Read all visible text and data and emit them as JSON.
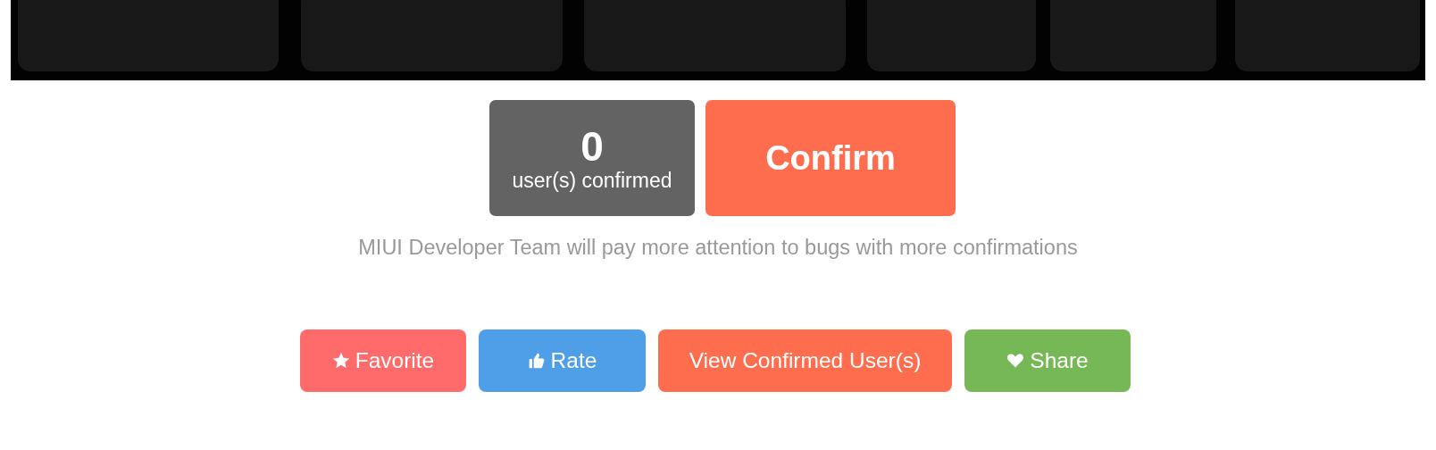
{
  "confirm_panel": {
    "count": "0",
    "count_label": "user(s) confirmed",
    "confirm_button": "Confirm"
  },
  "note": "MIUI Developer Team will pay more attention to bugs with more confirmations",
  "actions": [
    {
      "label": "Favorite",
      "kind": "favorite",
      "color": "#ff6b6b"
    },
    {
      "label": "Rate",
      "kind": "rate",
      "color": "#4f9fe8"
    },
    {
      "label": "View Confirmed User(s)",
      "kind": "list",
      "color": "#ff6d4f"
    },
    {
      "label": "Share",
      "kind": "share",
      "color": "#76b756"
    }
  ]
}
